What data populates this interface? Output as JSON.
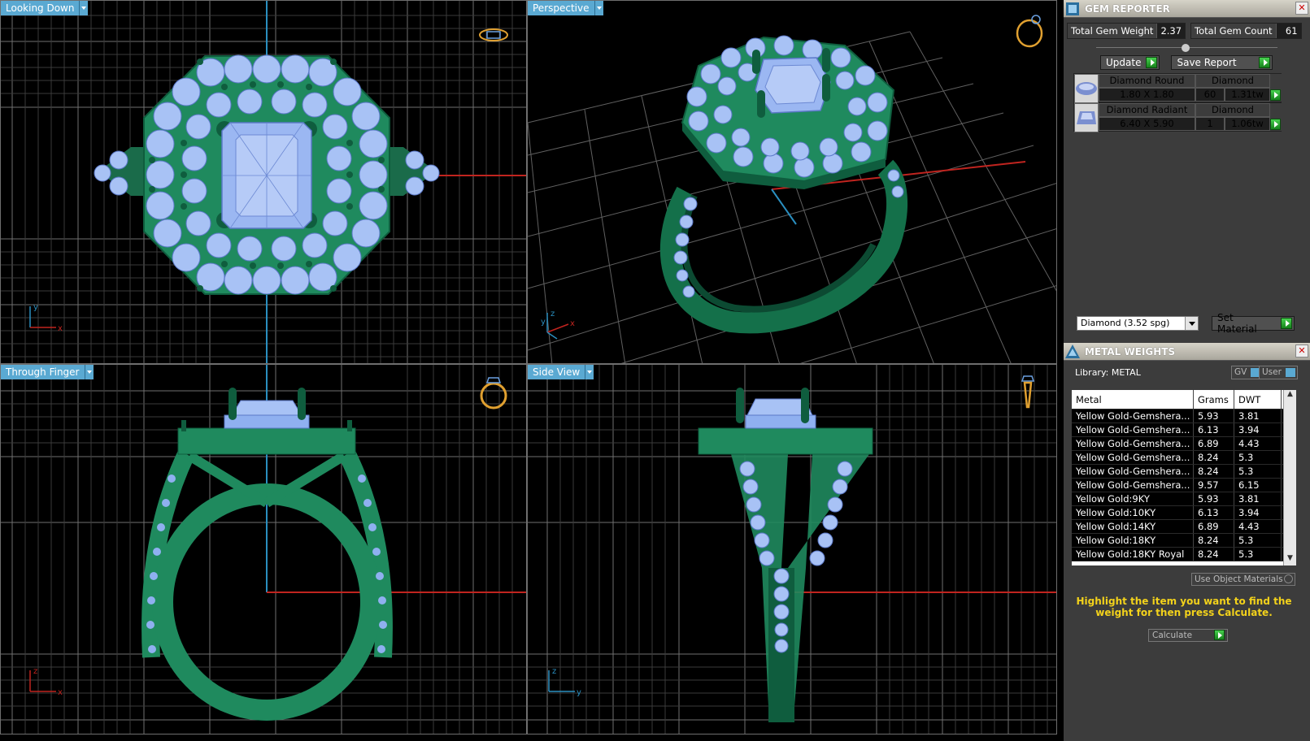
{
  "viewports": {
    "top": {
      "title": "Looking Down",
      "axis_x": "x",
      "axis_y": "y"
    },
    "perspective": {
      "title": "Perspective",
      "axis_x": "x",
      "axis_y": "y",
      "axis_z": "z"
    },
    "front": {
      "title": "Through Finger",
      "axis_x": "x",
      "axis_z": "z"
    },
    "side": {
      "title": "Side View",
      "axis_y": "y",
      "axis_z": "z"
    }
  },
  "gem_reporter": {
    "title": "GEM REPORTER",
    "total_weight_label": "Total Gem Weight",
    "total_weight_value": "2.37",
    "total_count_label": "Total Gem Count",
    "total_count_value": "61",
    "update_label": "Update",
    "save_report_label": "Save Report",
    "gems": [
      {
        "name": "Diamond Round",
        "type": "Diamond",
        "size": "1.80 X 1.80",
        "count": "60",
        "weight": "1.31tw"
      },
      {
        "name": "Diamond Radiant",
        "type": "Diamond",
        "size": "6.40 X 5.90",
        "count": "1",
        "weight": "1.06tw"
      }
    ],
    "material_select": "Diamond    (3.52 spg)",
    "set_material_label": "Set Material"
  },
  "metal_weights": {
    "title": "METAL WEIGHTS",
    "library_label": "Library: METAL",
    "gv_label": "GV",
    "user_label": "User",
    "columns": [
      "Metal",
      "Grams",
      "DWT"
    ],
    "rows": [
      [
        "Yellow Gold-Gemshera...",
        "5.93",
        "3.81"
      ],
      [
        "Yellow Gold-Gemshera...",
        "6.13",
        "3.94"
      ],
      [
        "Yellow Gold-Gemshera...",
        "6.89",
        "4.43"
      ],
      [
        "Yellow Gold-Gemshera...",
        "8.24",
        "5.3"
      ],
      [
        "Yellow Gold-Gemshera...",
        "8.24",
        "5.3"
      ],
      [
        "Yellow Gold-Gemshera...",
        "9.57",
        "6.15"
      ],
      [
        "Yellow Gold:9KY",
        "5.93",
        "3.81"
      ],
      [
        "Yellow Gold:10KY",
        "6.13",
        "3.94"
      ],
      [
        "Yellow Gold:14KY",
        "6.89",
        "4.43"
      ],
      [
        "Yellow Gold:18KY",
        "8.24",
        "5.3"
      ],
      [
        "Yellow Gold:18KY Royal",
        "8.24",
        "5.3"
      ]
    ],
    "use_object_materials": "Use Object Materials",
    "instruction": "Highlight the item you want to find the weight for then press Calculate.",
    "calculate_label": "Calculate"
  },
  "colors": {
    "metal": "#1f7a55",
    "gem": "#8fb0f0",
    "grid": "#6a6a6a",
    "accent": "#5aa9d2",
    "x_axis": "#c0241f",
    "y_axis": "#2a8fc0",
    "instruction": "#f3d21b"
  }
}
